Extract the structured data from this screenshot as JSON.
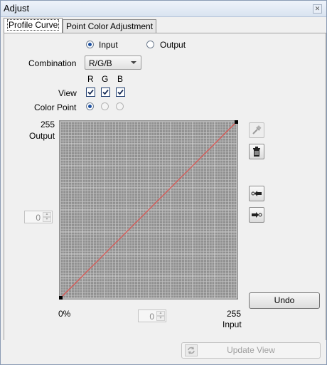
{
  "window": {
    "title": "Adjust"
  },
  "tabs": [
    {
      "label": "Profile Curve",
      "active": true
    },
    {
      "label": "Point Color Adjustment",
      "active": false
    }
  ],
  "mode": {
    "input_label": "Input",
    "output_label": "Output",
    "selected": "Input"
  },
  "combination": {
    "label": "Combination",
    "value": "R/G/B"
  },
  "channels": {
    "r": "R",
    "g": "G",
    "b": "B"
  },
  "view": {
    "label": "View",
    "r": true,
    "g": true,
    "b": true
  },
  "color_point": {
    "label": "Color Point",
    "selected": "R"
  },
  "graph": {
    "y_max_label": "255",
    "y_axis_label": "Output",
    "x_min_label": "0%",
    "x_max_label": "255",
    "x_axis_label": "Input",
    "curve_color": "#d9534f",
    "grid_color": "#c2c2c2",
    "background_color": "#909090",
    "points": [
      [
        0,
        0
      ],
      [
        255,
        255
      ]
    ]
  },
  "output_spinner": {
    "value": "0"
  },
  "input_spinner": {
    "value": "0"
  },
  "tools": {
    "eyedropper": "eyedropper-icon",
    "delete": "trash-icon",
    "prev_point": "arrow-left-point-icon",
    "next_point": "arrow-right-point-icon"
  },
  "undo_label": "Undo",
  "update_view_label": "Update View"
}
